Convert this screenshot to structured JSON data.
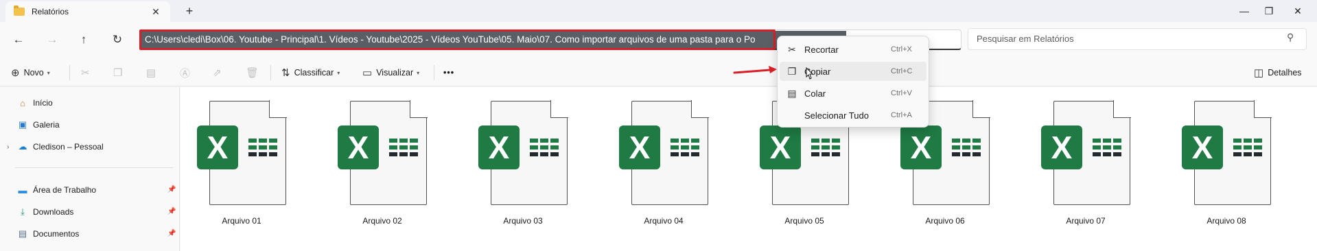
{
  "tab": {
    "title": "Relatórios",
    "close": "✕",
    "new_tab": "+"
  },
  "window": {
    "minimize": "—",
    "maximize": "❐",
    "close": "✕"
  },
  "nav": {
    "back": "←",
    "forward": "→",
    "up": "↑",
    "refresh": "↻"
  },
  "address": {
    "path": "C:\\Users\\cledi\\Box\\06. Youtube - Principal\\1. Vídeos - Youtube\\2025 - Vídeos YouTube\\05. Maio\\07. Como importar arquivos de uma pasta para o Po"
  },
  "search": {
    "placeholder": "Pesquisar em Relatórios",
    "icon": "search-icon"
  },
  "commands": {
    "new_label": "Novo",
    "sort_label": "Classificar",
    "view_label": "Visualizar",
    "more": "•••",
    "details_label": "Detalhes"
  },
  "sidebar": {
    "items": [
      {
        "label": "Início",
        "icon": "home-icon"
      },
      {
        "label": "Galeria",
        "icon": "gallery-icon"
      },
      {
        "label": "Cledison – Pessoal",
        "icon": "cloud-icon"
      },
      {
        "label": "Área de Trabalho",
        "icon": "desktop-icon"
      },
      {
        "label": "Downloads",
        "icon": "download-icon"
      },
      {
        "label": "Documentos",
        "icon": "documents-icon"
      }
    ]
  },
  "files": [
    {
      "name": "Arquivo 01"
    },
    {
      "name": "Arquivo 02"
    },
    {
      "name": "Arquivo 03"
    },
    {
      "name": "Arquivo 04"
    },
    {
      "name": "Arquivo 05"
    },
    {
      "name": "Arquivo 06"
    },
    {
      "name": "Arquivo 07"
    },
    {
      "name": "Arquivo 08"
    }
  ],
  "file_icon_letter": "X",
  "context_menu": {
    "items": [
      {
        "label": "Recortar",
        "shortcut": "Ctrl+X"
      },
      {
        "label": "Copiar",
        "shortcut": "Ctrl+C"
      },
      {
        "label": "Colar",
        "shortcut": "Ctrl+V"
      },
      {
        "label": "Selecionar Tudo",
        "shortcut": "Ctrl+A"
      }
    ]
  },
  "colors": {
    "highlight_box": "#d61f26",
    "excel_green": "#1f7a44",
    "selection": "#5a5f66"
  }
}
